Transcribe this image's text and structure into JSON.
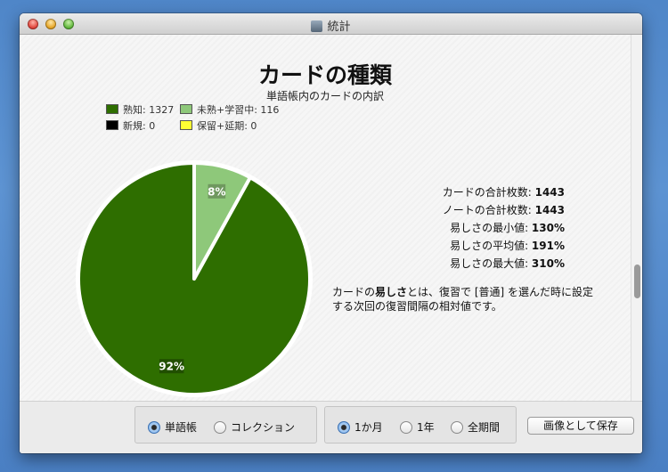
{
  "window": {
    "title": "統計"
  },
  "header": {
    "title": "カードの種類",
    "subtitle": "単語帳内のカードの内訳"
  },
  "legend": [
    {
      "label": "熟知: 1327",
      "color": "#2e6e00"
    },
    {
      "label": "未熟+学習中: 116",
      "color": "#8ec87a"
    },
    {
      "label": "新規: 0",
      "color": "#000000"
    },
    {
      "label": "保留+延期: 0",
      "color": "#ffff33"
    }
  ],
  "chart_data": {
    "type": "pie",
    "title": "カードの種類",
    "subtitle": "単語帳内のカードの内訳",
    "labels": [
      "熟知",
      "未熟+学習中",
      "新規",
      "保留+延期"
    ],
    "values": [
      1327,
      116,
      0,
      0
    ],
    "colors": [
      "#2e6e00",
      "#8ec87a",
      "#000000",
      "#ffff33"
    ],
    "slice_labels": [
      "92%",
      "8%"
    ],
    "legend_position": "top-left"
  },
  "stats": [
    {
      "label": "カードの合計枚数: ",
      "value": "1443"
    },
    {
      "label": "ノートの合計枚数: ",
      "value": "1443"
    },
    {
      "label": "易しさの最小値: ",
      "value": "130%"
    },
    {
      "label": "易しさの平均値: ",
      "value": "191%"
    },
    {
      "label": "易しさの最大値: ",
      "value": "310%"
    }
  ],
  "note": {
    "prefix": "カードの",
    "bold": "易しさ",
    "suffix": "とは、復習で [普通] を選んだ時に設定する次回の復習間隔の相対値です。"
  },
  "controls": {
    "scope": {
      "options": [
        "単語帳",
        "コレクション"
      ],
      "selected": "単語帳"
    },
    "period": {
      "options": [
        "1か月",
        "1年",
        "全期間"
      ],
      "selected": "1か月"
    },
    "save_label": "画像として保存"
  }
}
